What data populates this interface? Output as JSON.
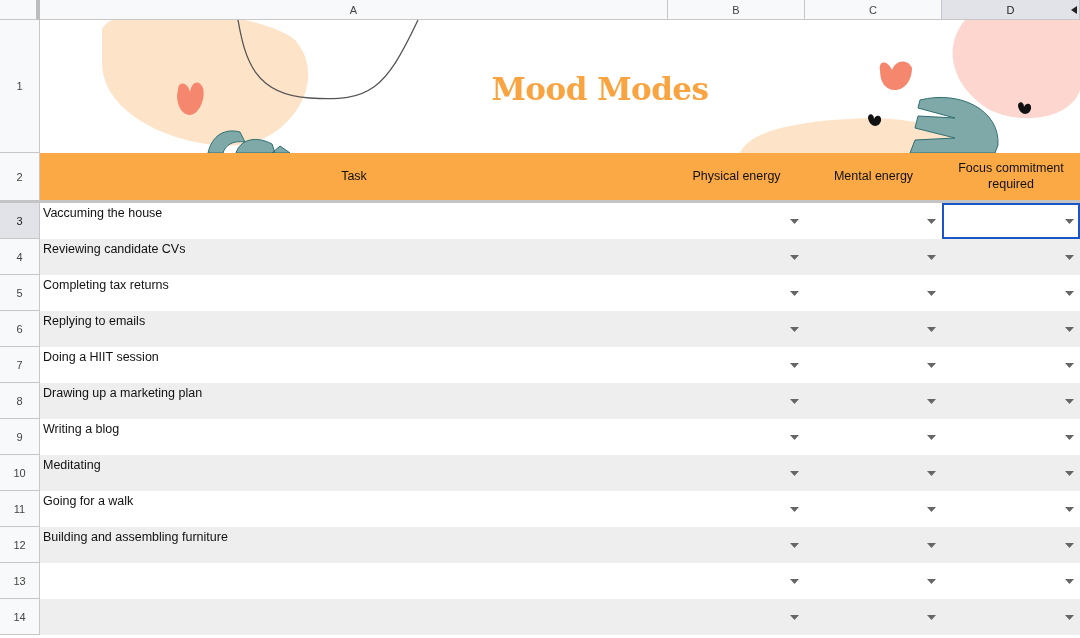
{
  "column_headers": [
    {
      "label": "A",
      "selected": false
    },
    {
      "label": "B",
      "selected": false
    },
    {
      "label": "C",
      "selected": false
    },
    {
      "label": "D",
      "selected": true
    }
  ],
  "banner": {
    "row_number": "1",
    "title": "Mood Modes"
  },
  "header_row": {
    "row_number": "2",
    "cells": [
      "Task",
      "Physical energy",
      "Mental energy",
      "Focus commitment required"
    ]
  },
  "rows": [
    {
      "number": "3",
      "task": "Vaccuming the house",
      "selected": true
    },
    {
      "number": "4",
      "task": "Reviewing candidate CVs",
      "selected": false
    },
    {
      "number": "5",
      "task": "Completing tax returns",
      "selected": false
    },
    {
      "number": "6",
      "task": "Replying to emails",
      "selected": false
    },
    {
      "number": "7",
      "task": "Doing a HIIT session",
      "selected": false
    },
    {
      "number": "8",
      "task": "Drawing up a marketing plan",
      "selected": false
    },
    {
      "number": "9",
      "task": "Writing a blog",
      "selected": false
    },
    {
      "number": "10",
      "task": "Meditating",
      "selected": false
    },
    {
      "number": "11",
      "task": "Going for a walk",
      "selected": false
    },
    {
      "number": "12",
      "task": "Building and assembling furniture",
      "selected": false
    },
    {
      "number": "13",
      "selected": false
    },
    {
      "number": "14",
      "selected": false
    }
  ]
}
